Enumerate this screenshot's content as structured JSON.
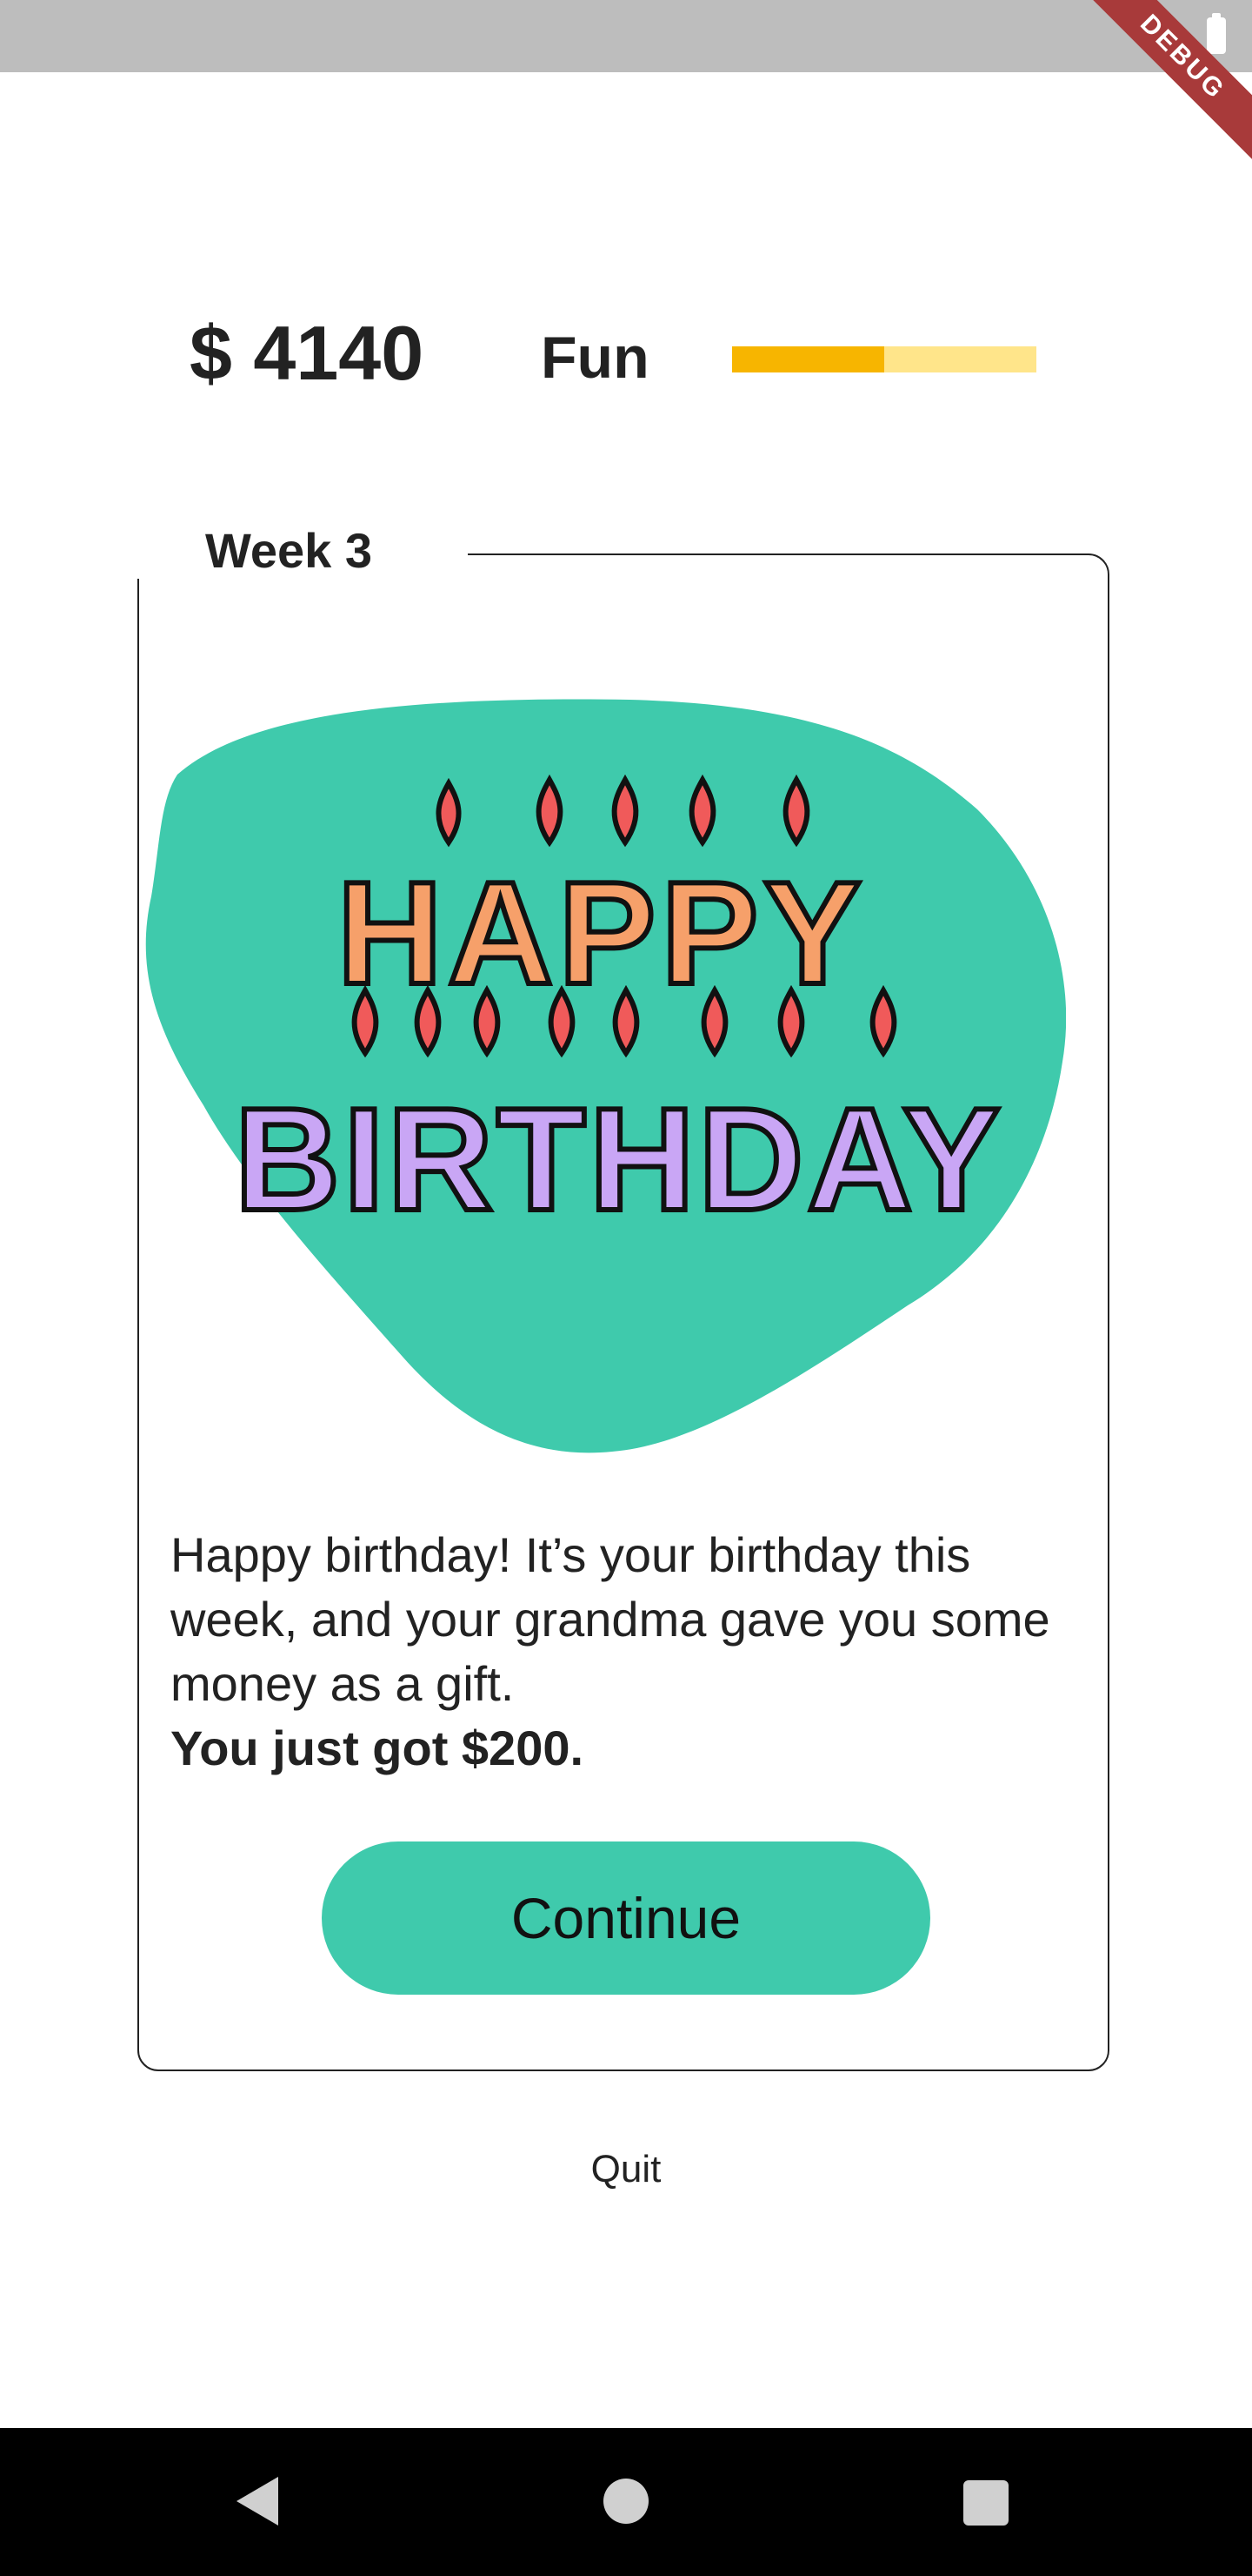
{
  "status_bar": {
    "battery_icon": "battery-icon",
    "debug_label": "DEBUG"
  },
  "header": {
    "money": "$ 4140",
    "fun_label": "Fun",
    "fun_level": 0.5,
    "fun_colors": {
      "fill": "#f7b500",
      "track": "#ffe58a"
    }
  },
  "card": {
    "title": "Week 3",
    "image_icon": "happy-birthday-candles-illustration",
    "image_text_line1": "HAPPY",
    "image_text_line2": "BIRTHDAY",
    "story_text": "Happy birthday! It’s your birthday this week, and your grandma gave you some money as a gift.",
    "story_bold": "You just got $200.",
    "continue_label": "Continue",
    "accent_color": "#3fcaac"
  },
  "footer": {
    "quit_label": "Quit"
  },
  "nav_bar": {
    "back_icon": "back-icon",
    "home_icon": "home-icon",
    "recent_icon": "recent-apps-icon"
  }
}
